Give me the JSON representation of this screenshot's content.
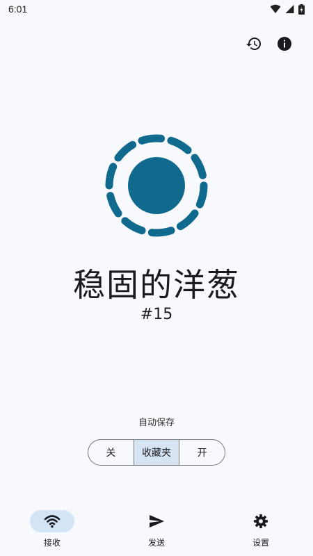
{
  "status_bar": {
    "time": "6:01",
    "icons": [
      "wifi-icon",
      "signal-icon",
      "battery-icon"
    ]
  },
  "header_actions": [
    "history-icon",
    "info-icon"
  ],
  "device": {
    "name": "稳固的洋葱",
    "number": "#15"
  },
  "autosave": {
    "label": "自动保存",
    "options": [
      "关",
      "收藏夹",
      "开"
    ],
    "selected": "收藏夹"
  },
  "bottom_nav": {
    "items": [
      {
        "label": "接收",
        "icon": "wifi-icon",
        "active": true
      },
      {
        "label": "发送",
        "icon": "send-icon",
        "active": false
      },
      {
        "label": "设置",
        "icon": "gear-icon",
        "active": false
      }
    ]
  },
  "colors": {
    "accent": "#0f6a8e",
    "background": "#f8f9fd",
    "selected_segment": "#d6e3f2"
  }
}
